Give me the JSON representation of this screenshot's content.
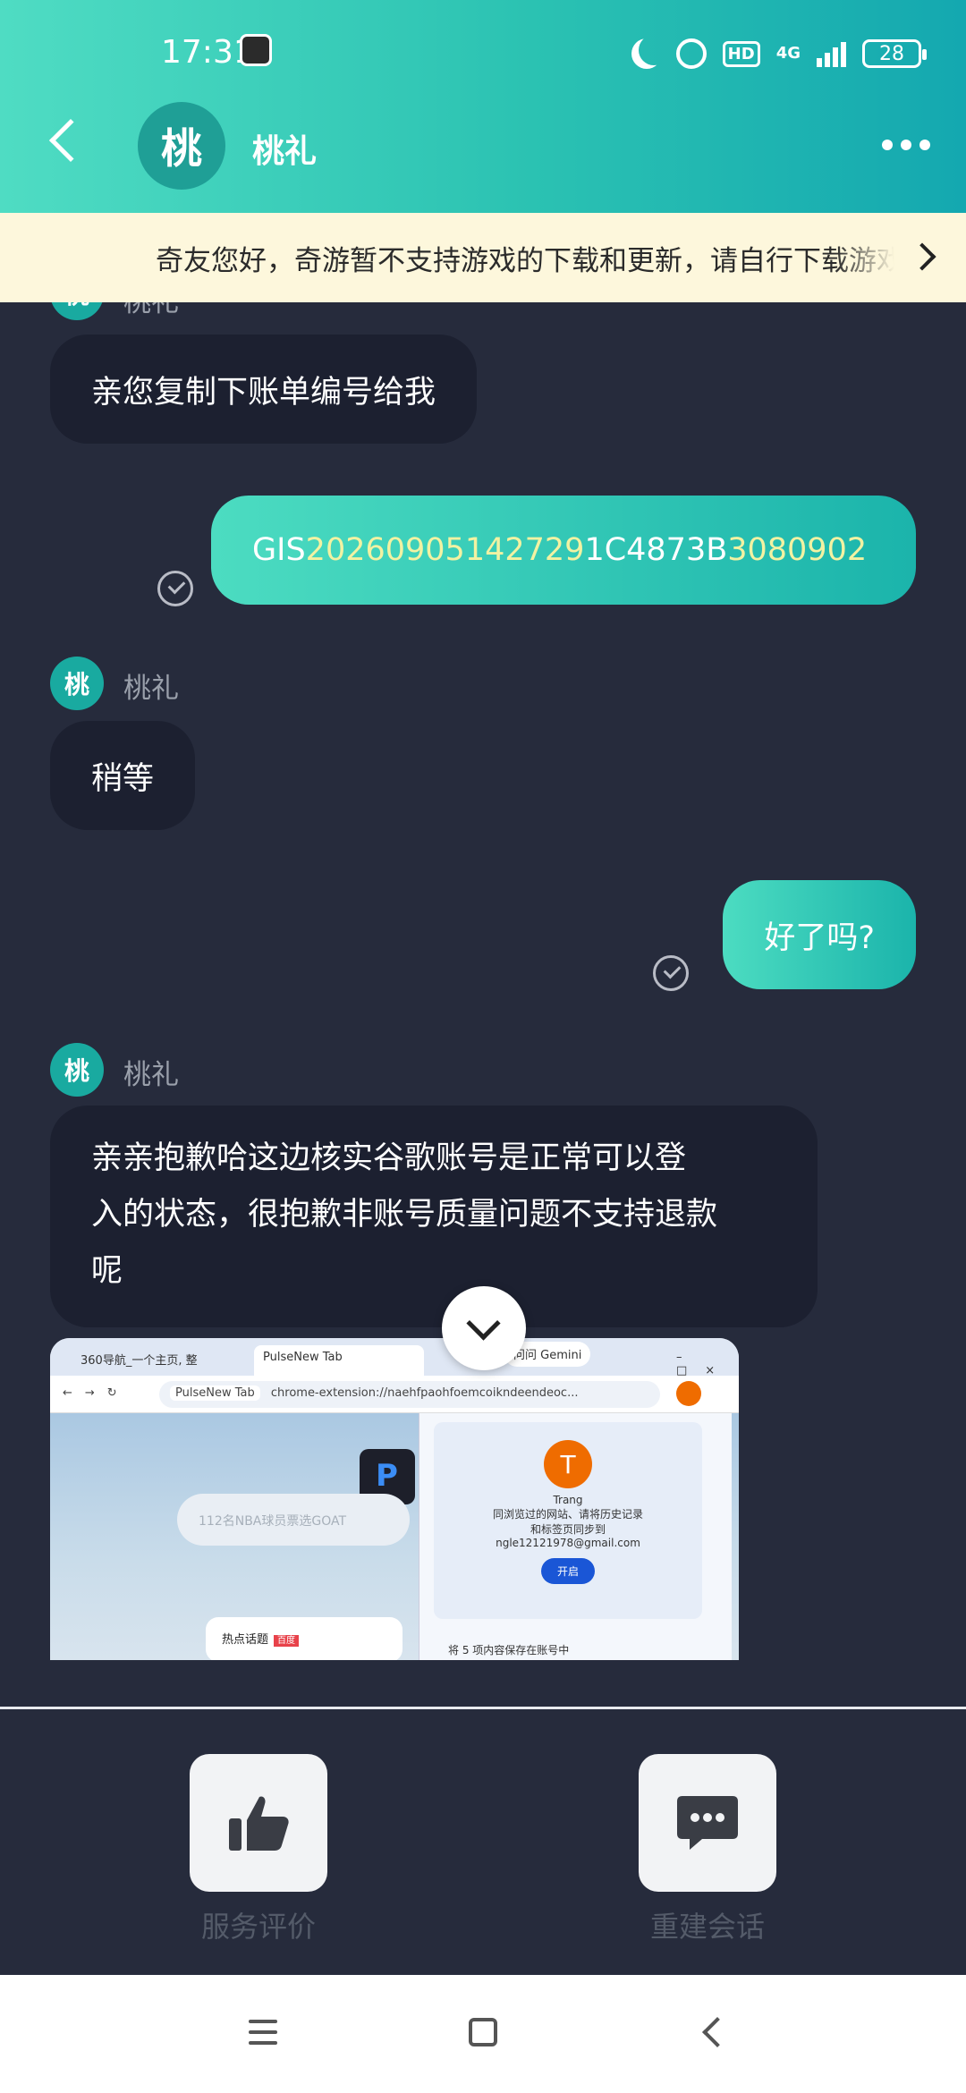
{
  "status_bar": {
    "time": "17:31",
    "network": "4G",
    "hd_label": "HD",
    "battery": "28"
  },
  "header": {
    "avatar_char": "桃",
    "contact_name": "桃礼"
  },
  "notice": {
    "text": "奇友您好，奇游暂不支持游戏的下载和更新，请自行下载游戏"
  },
  "messages": {
    "top_sender_partial": "桃礼",
    "m1": "亲您复制下账单编号给我",
    "m2": {
      "part1": "GIS",
      "part2": "20260905142729",
      "part3": "1C4873B",
      "part4": "3080902"
    },
    "m3_sender": "桃礼",
    "m3": "稍等",
    "m4": "好了吗?",
    "m5_sender": "桃礼",
    "m5_line1": "亲亲抱歉哈这边核实谷歌账号是正常可以登",
    "m5_line2": "入的状态，很抱歉非账号质量问题不支持退款",
    "m5_line3": "呢"
  },
  "screenshot": {
    "tab1": "360导航_一个主页, 整",
    "tab2": "PulseNew Tab",
    "gemini": "问问 Gemini",
    "url_chip": "PulseNew Tab",
    "url": "chrome-extension://naehfpaohfoemcoikndeendeoc...",
    "search_placeholder": "112名NBA球员票选GOAT",
    "hot_label": "热点话题",
    "hot_tag": "百度",
    "account_initial": "T",
    "account_name": "Trang",
    "sync_line1": "同浏览过的网站、请将历史记录",
    "sync_line2": "和标签页同步到",
    "email": "ngle12121978@gmail.com",
    "open_button": "开启",
    "save_note": "将 5 项内容保存在账号中"
  },
  "actions": {
    "rate": "服务评价",
    "new_session": "重建会话"
  },
  "colors": {
    "header_start": "#4fdcc3",
    "header_end": "#14a8b0",
    "chat_bg": "#262b3c",
    "bubble_left": "#1c2030",
    "highlight": "#f2f2a2"
  }
}
